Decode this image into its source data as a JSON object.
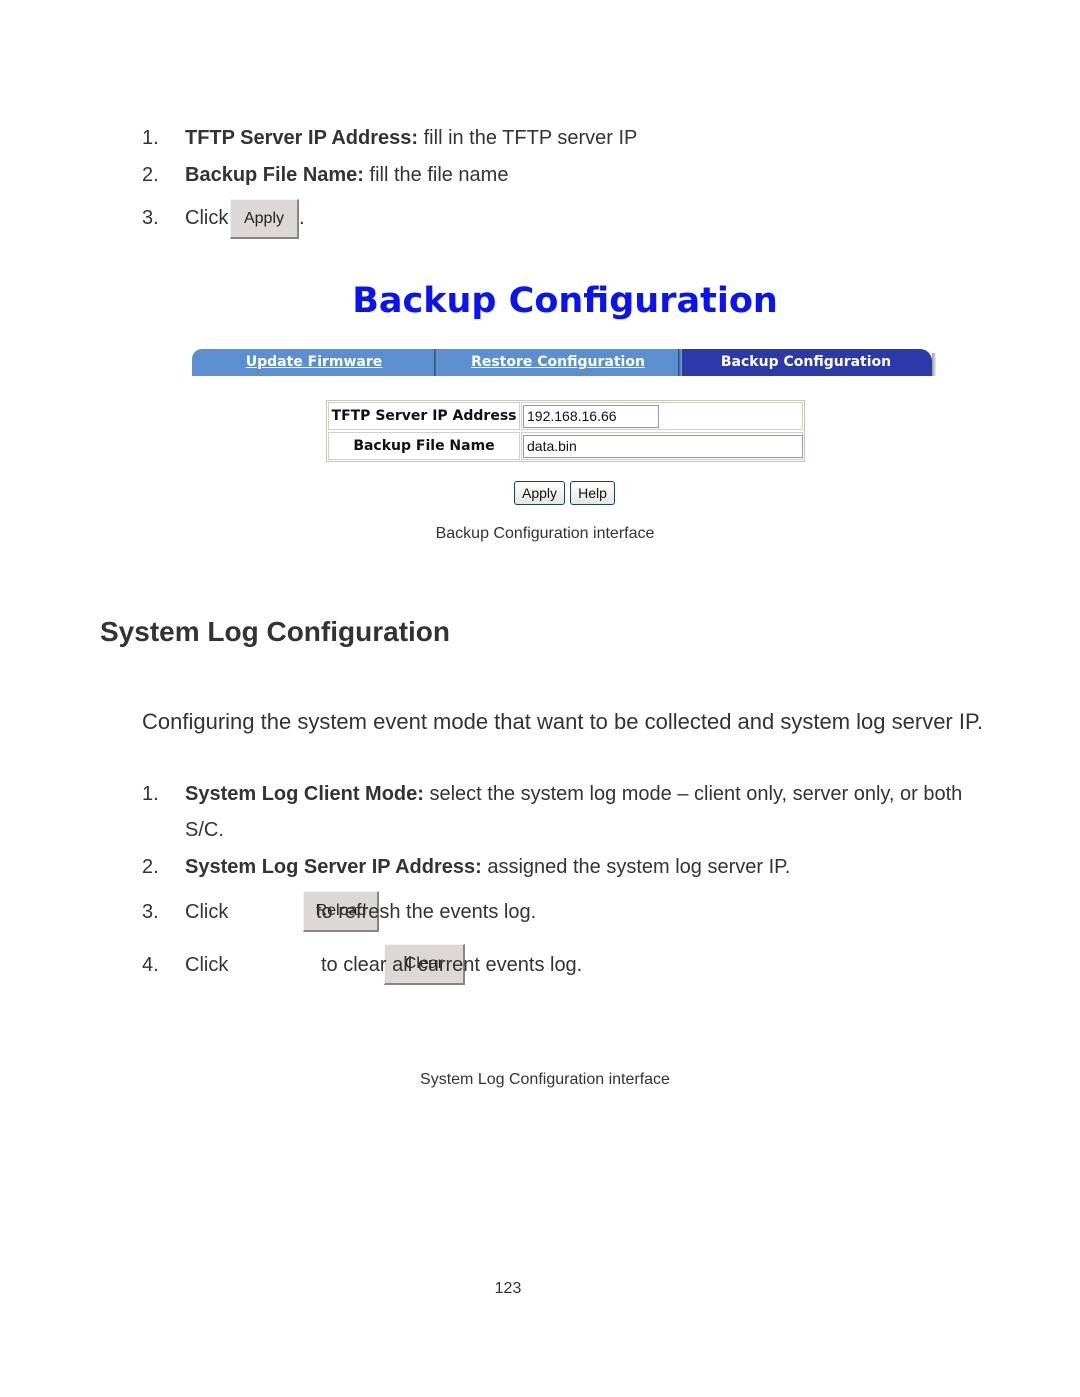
{
  "intro_steps": [
    {
      "number": "1.",
      "bold": "TFTP Server IP Address:",
      "text": " fill in the TFTP server IP"
    },
    {
      "number": "2.",
      "bold": "Backup File Name:",
      "text": " fill the file name"
    },
    {
      "number": "3.",
      "prefix": "Click",
      "button": "Apply",
      "suffix": "."
    }
  ],
  "backup_ui": {
    "title": "Backup Configuration",
    "tabs": [
      {
        "label": "Update Firmware",
        "active": false
      },
      {
        "label": "Restore Configuration",
        "active": false
      },
      {
        "label": "Backup Configuration",
        "active": true
      }
    ],
    "fields": [
      {
        "label": "TFTP Server IP Address",
        "value": "192.168.16.66"
      },
      {
        "label": "Backup File Name",
        "value": "data.bin"
      }
    ],
    "buttons": {
      "apply": "Apply",
      "help": "Help"
    },
    "colors": {
      "title": "#0a14f0",
      "tab_inactive": "#5b8fd0",
      "tab_active": "#2c3aa8"
    }
  },
  "backup_caption": "Backup Configuration interface",
  "section": {
    "title": "System Log Configuration",
    "paragraph": "Configuring the system event mode that want to be collected and system log server IP.",
    "steps": [
      {
        "number": "1.",
        "bold": "System Log Client Mode:",
        "text": " select the system log mode – client only, server only, or both S/C."
      },
      {
        "number": "2.",
        "bold": "System Log Server IP Address:",
        "text": " assigned the system log server IP."
      },
      {
        "number": "3.",
        "prefix": "Click",
        "button": "Reload",
        "suffix": "to refresh the events log."
      },
      {
        "number": "4.",
        "prefix": "Click",
        "button": "Clear",
        "suffix": "to clear all current events log."
      }
    ]
  },
  "syslog_caption": "System Log Configuration interface",
  "page_number": "123"
}
